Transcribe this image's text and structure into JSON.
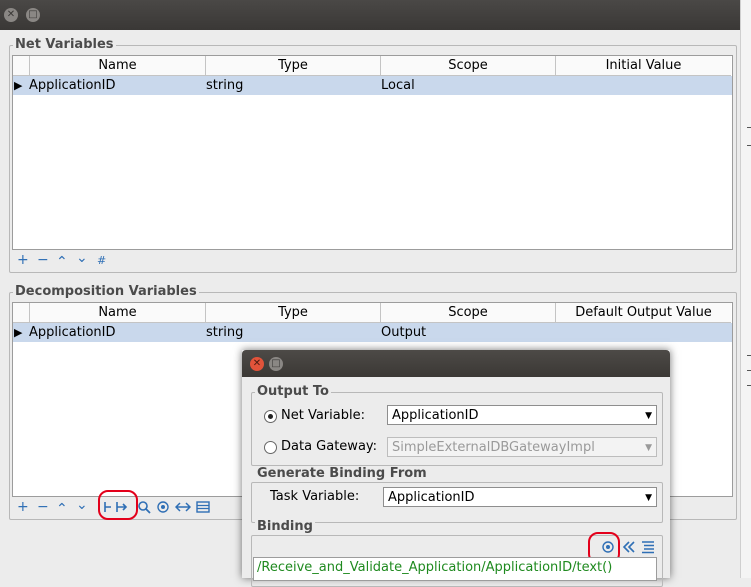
{
  "net_variables": {
    "title": "Net Variables",
    "columns": [
      "Name",
      "Type",
      "Scope",
      "Initial Value"
    ],
    "rows": [
      {
        "marker": "▶",
        "name": "ApplicationID",
        "type": "string",
        "scope": "Local",
        "value": ""
      }
    ],
    "toolbar": [
      "+",
      "−",
      "⌃",
      "⌄",
      "#"
    ]
  },
  "decomposition_variables": {
    "title": "Decomposition Variables",
    "columns": [
      "Name",
      "Type",
      "Scope",
      "Default Output Value"
    ],
    "rows": [
      {
        "marker": "▶",
        "name": "ApplicationID",
        "type": "string",
        "scope": "Output",
        "value": ""
      }
    ],
    "toolbar": [
      "+",
      "−",
      "⌃",
      "⌄"
    ]
  },
  "dialog": {
    "output_to": {
      "title": "Output To",
      "net_variable_label": "Net Variable:",
      "net_variable_value": "ApplicationID",
      "data_gateway_label": "Data Gateway:",
      "data_gateway_value": "SimpleExternalDBGatewayImpl"
    },
    "generate_binding": {
      "title": "Generate Binding From",
      "task_variable_label": "Task Variable:",
      "task_variable_value": "ApplicationID"
    },
    "binding": {
      "title": "Binding",
      "expression": "/Receive_and_Validate_Application/ApplicationID/text()"
    }
  },
  "colors": {
    "selection_row": "#c9d8ec",
    "toolbar_icon": "#2f6fb5",
    "binding_text": "#1f8a1f",
    "annotation": "#e3001b",
    "close_button": "#e2533a"
  }
}
